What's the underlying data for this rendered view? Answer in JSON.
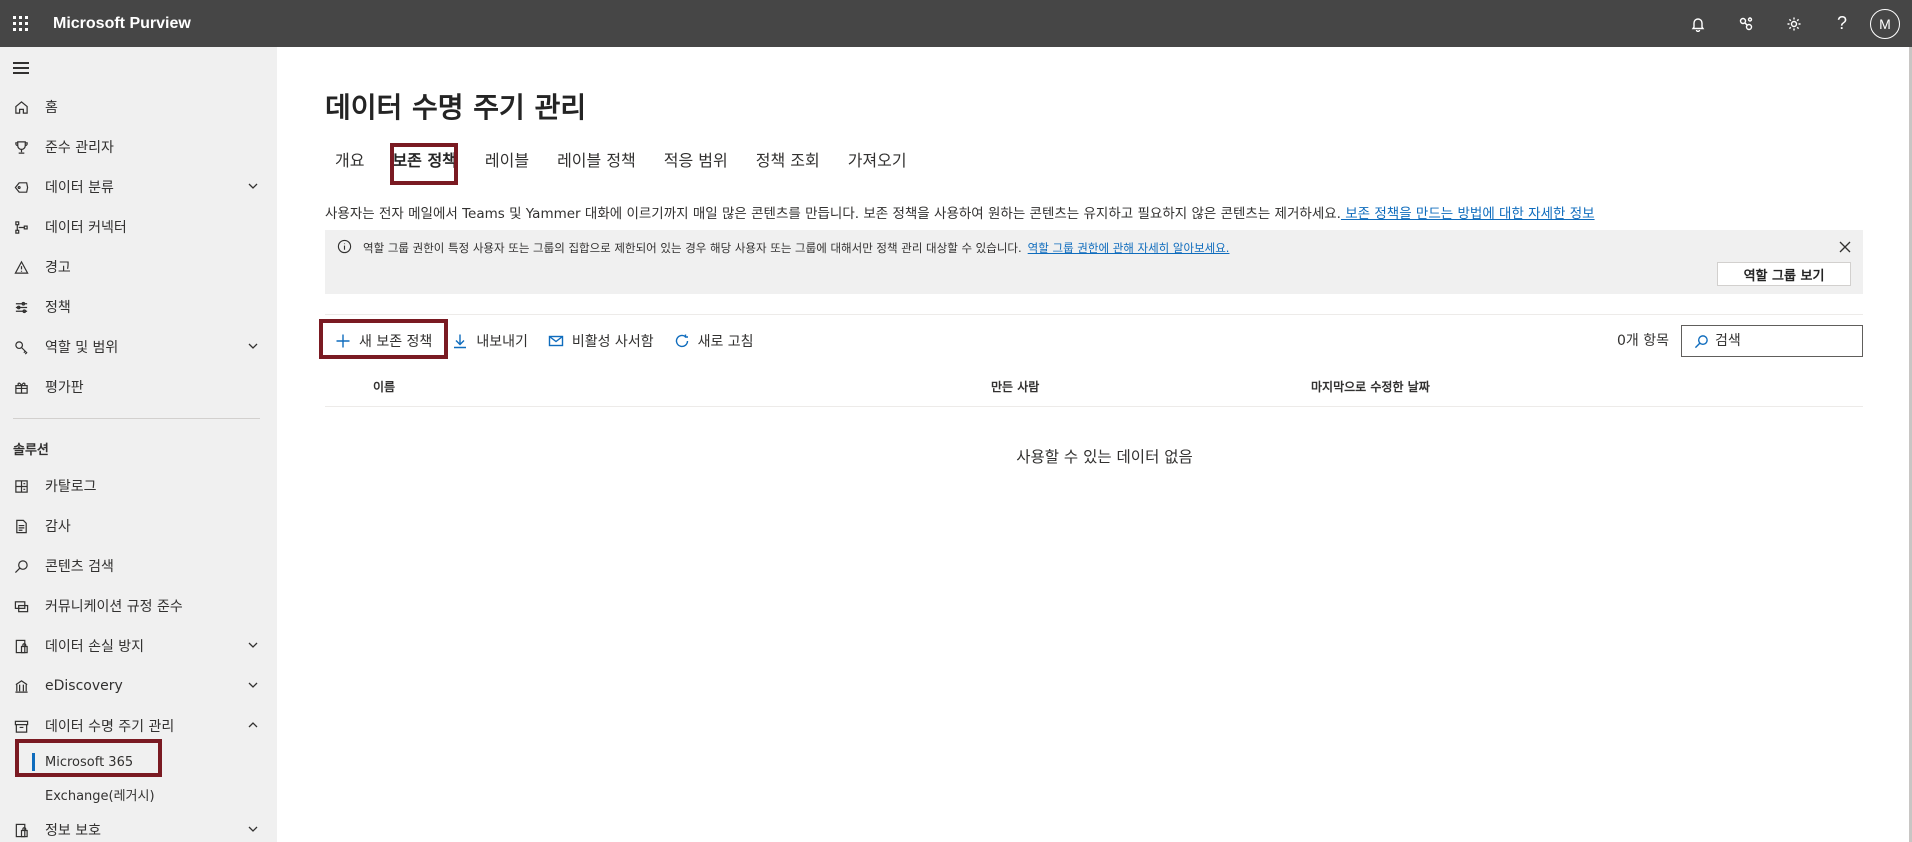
{
  "topbar": {
    "title": "Microsoft Purview",
    "avatar_initial": "M",
    "help": "?"
  },
  "sidebar": {
    "items": [
      {
        "label": "홈",
        "icon": "home-icon"
      },
      {
        "label": "준수 관리자",
        "icon": "trophy-icon"
      },
      {
        "label": "데이터 분류",
        "icon": "tag-icon",
        "expandable": true
      },
      {
        "label": "데이터 커넥터",
        "icon": "connector-icon"
      },
      {
        "label": "경고",
        "icon": "warning-icon"
      },
      {
        "label": "정책",
        "icon": "policy-icon"
      },
      {
        "label": "역할 및 범위",
        "icon": "key-icon",
        "expandable": true
      },
      {
        "label": "평가판",
        "icon": "trial-icon"
      }
    ],
    "section_title": "솔루션",
    "solutions": [
      {
        "label": "카탈로그",
        "icon": "catalog-icon"
      },
      {
        "label": "감사",
        "icon": "audit-icon"
      },
      {
        "label": "콘텐츠 검색",
        "icon": "search-icon"
      },
      {
        "label": "커뮤니케이션 규정 준수",
        "icon": "communication-icon"
      },
      {
        "label": "데이터 손실 방지",
        "icon": "dlp-icon",
        "expandable": true
      },
      {
        "label": "eDiscovery",
        "icon": "ediscovery-icon",
        "expandable": true
      },
      {
        "label": "데이터 수명 주기 관리",
        "icon": "archive-icon",
        "expanded": true
      }
    ],
    "sub_items": [
      {
        "label": "Microsoft 365",
        "selected": true
      },
      {
        "label": "Exchange(레거시)"
      }
    ],
    "last_item": {
      "label": "정보 보호",
      "icon": "info-protection-icon",
      "expandable": true
    }
  },
  "main": {
    "title": "데이터 수명 주기 관리",
    "tabs": [
      "개요",
      "보존 정책",
      "레이블",
      "레이블 정책",
      "적응 범위",
      "정책 조회",
      "가져오기"
    ],
    "active_tab": "보존 정책",
    "description": "사용자는 전자 메일에서 Teams 및 Yammer 대화에 이르기까지 매일 많은 콘텐츠를 만듭니다. 보존 정책을 사용하여 원하는 콘텐츠는 유지하고 필요하지 않은 콘텐츠는 제거하세요.",
    "description_link": " 보존 정책을 만드는 방법에 대한 자세한 정보",
    "info": {
      "text": "역할 그룹 권한이 특정 사용자 또는 그룹의 집합으로 제한되어 있는 경우 해당 사용자 또는 그룹에 대해서만 정책 관리 대상할 수 있습니다.",
      "link": "역할 그룹 권한에 관해 자세히 알아보세요.",
      "button": "역할 그룹 보기"
    },
    "toolbar": {
      "new_policy": "새 보존 정책",
      "export": "내보내기",
      "inactive_mailbox": "비활성 사서함",
      "refresh": "새로 고침"
    },
    "item_count": "0개 항목",
    "search_placeholder": "검색",
    "columns": [
      "이름",
      "만든 사람",
      "마지막으로 수정한 날짜"
    ],
    "empty_message": "사용할 수 있는 데이터 없음"
  },
  "colors": {
    "topbar": "#464646",
    "sidebar": "#f0f0f0",
    "accent": "#0f6cbd",
    "highlight_border": "#7a1a22"
  }
}
